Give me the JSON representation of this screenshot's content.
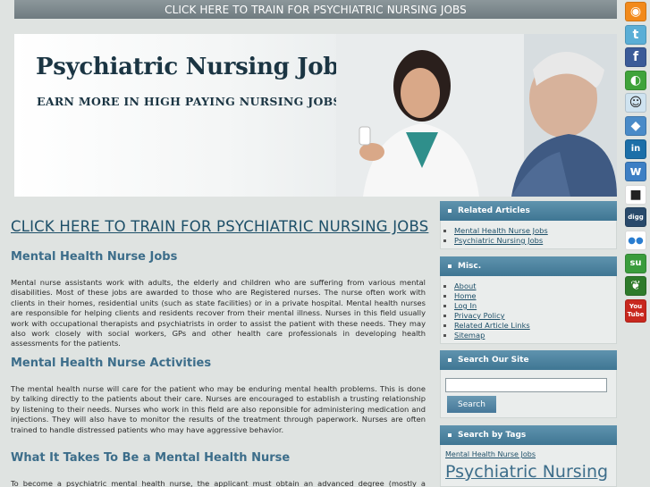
{
  "topbar": {
    "link": "CLICK HERE TO TRAIN FOR PSYCHIATRIC NURSING JOBS"
  },
  "banner": {
    "title": "Psychiatric Nursing Jobs",
    "subtitle": "EARN MORE IN HIGH PAYING NURSING JOBS"
  },
  "main": {
    "cta_link": "CLICK HERE TO TRAIN FOR PSYCHIATRIC NURSING JOBS",
    "sections": [
      {
        "heading": "Mental Health Nurse Jobs",
        "text": "Mental nurse assistants work with adults, the elderly and children who are suffering from various mental disabilities. Most of these jobs are awarded to those who are Registered nurses. The nurse often work with clients in their homes, residential units (such as state facilities) or in a private hospital. Mental health nurses are responsible for helping clients and residents recover from their mental illness. Nurses in this field usually work with occupational therapists and psychiatrists in order to assist the patient with these needs. They may also work closely with social workers, GPs and other health care professionals in developing health assessments for the patients."
      },
      {
        "heading": "Mental Health Nurse Activities",
        "text": "The mental health nurse will care for the patient who may be enduring mental health problems. This is done by talking directly to the patients about their care. Nurses are encouraged to establish a trusting relationship by listening to their needs. Nurses who work in this field are also reponsible for administering medication and injections. They will also have to monitor the results of the treatment through paperwork. Nurses are often trained to handle distressed patients who may have aggressive behavior."
      },
      {
        "heading": "What It Takes To Be a Mental Health Nurse",
        "text": "To become a psychiatric mental health nurse, the applicant must obtain an advanced degree (mostly a Bachelors or"
      }
    ]
  },
  "sidebar": {
    "related": {
      "title": "Related Articles",
      "links": [
        "Mental Health Nurse Jobs",
        "Psychiatric Nursing Jobs"
      ]
    },
    "misc": {
      "title": "Misc.",
      "links": [
        "About",
        "Home",
        "Log In",
        "Privacy Policy",
        "Related Article Links",
        "Sitemap"
      ]
    },
    "search": {
      "title": "Search Our Site",
      "button": "Search",
      "value": ""
    },
    "tags": {
      "title": "Search by Tags",
      "small": "Mental Health Nurse Jobs",
      "large": "Psychiatric Nursing"
    }
  },
  "social": [
    {
      "name": "rss-icon",
      "glyph": "◉",
      "color": "#f28a1b"
    },
    {
      "name": "twitter-icon",
      "glyph": "t",
      "color": "#5aaed6"
    },
    {
      "name": "facebook-icon",
      "glyph": "f",
      "color": "#3b5b98"
    },
    {
      "name": "chat-icon",
      "glyph": "◐",
      "color": "#3fa33a"
    },
    {
      "name": "reddit-icon",
      "glyph": "☺",
      "color": "#cfe3f0"
    },
    {
      "name": "myspace-icon",
      "glyph": "◆",
      "color": "#4a8bc8"
    },
    {
      "name": "linkedin-icon",
      "glyph": "in",
      "color": "#1c6fa8"
    },
    {
      "name": "windows-live-icon",
      "glyph": "w",
      "color": "#3d7fc4"
    },
    {
      "name": "delicious-icon",
      "glyph": "■",
      "color": "#ffffff"
    },
    {
      "name": "digg-icon",
      "glyph": "digg",
      "color": "#294a6b"
    },
    {
      "name": "flickr-icon",
      "glyph": "●●",
      "color": "#ffffff"
    },
    {
      "name": "stumbleupon-icon",
      "glyph": "su",
      "color": "#3a9c3c"
    },
    {
      "name": "plant-icon",
      "glyph": "❦",
      "color": "#2e7a2b"
    },
    {
      "name": "youtube-icon",
      "glyph": "You Tube",
      "color": "#c8281e"
    }
  ]
}
